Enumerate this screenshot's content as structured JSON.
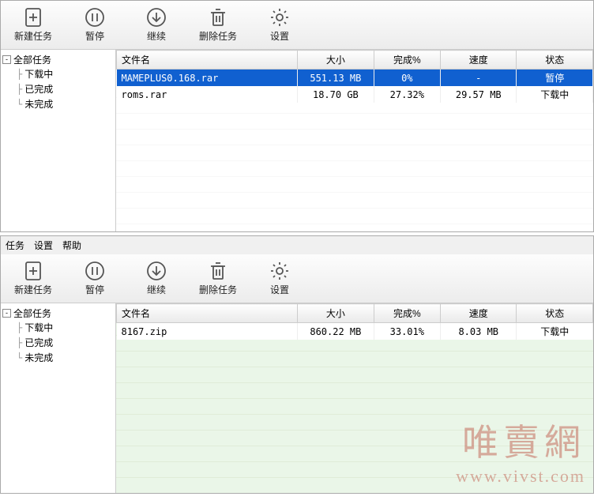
{
  "toolbar": {
    "newTask": "新建任务",
    "pause": "暂停",
    "resume": "继续",
    "delete": "删除任务",
    "settings": "设置"
  },
  "menubar": {
    "task": "任务",
    "settings": "设置",
    "help": "帮助"
  },
  "sidebar": {
    "root": "全部任务",
    "items": [
      "下载中",
      "已完成",
      "未完成"
    ]
  },
  "columns": {
    "filename": "文件名",
    "size": "大小",
    "percent": "完成%",
    "speed": "速度",
    "status": "状态"
  },
  "window1": {
    "rows": [
      {
        "filename": "MAMEPLUS0.168.rar",
        "size": "551.13 MB",
        "percent": "0%",
        "speed": "-",
        "status": "暂停",
        "selected": true
      },
      {
        "filename": "roms.rar",
        "size": "18.70 GB",
        "percent": "27.32%",
        "speed": "29.57 MB",
        "status": "下载中",
        "selected": false
      }
    ]
  },
  "window2": {
    "rows": [
      {
        "filename": "8167.zip",
        "size": "860.22 MB",
        "percent": "33.01%",
        "speed": "8.03 MB",
        "status": "下载中",
        "selected": false
      }
    ]
  },
  "watermark": {
    "text": "唯賣網",
    "url": "www.vivst.com"
  }
}
